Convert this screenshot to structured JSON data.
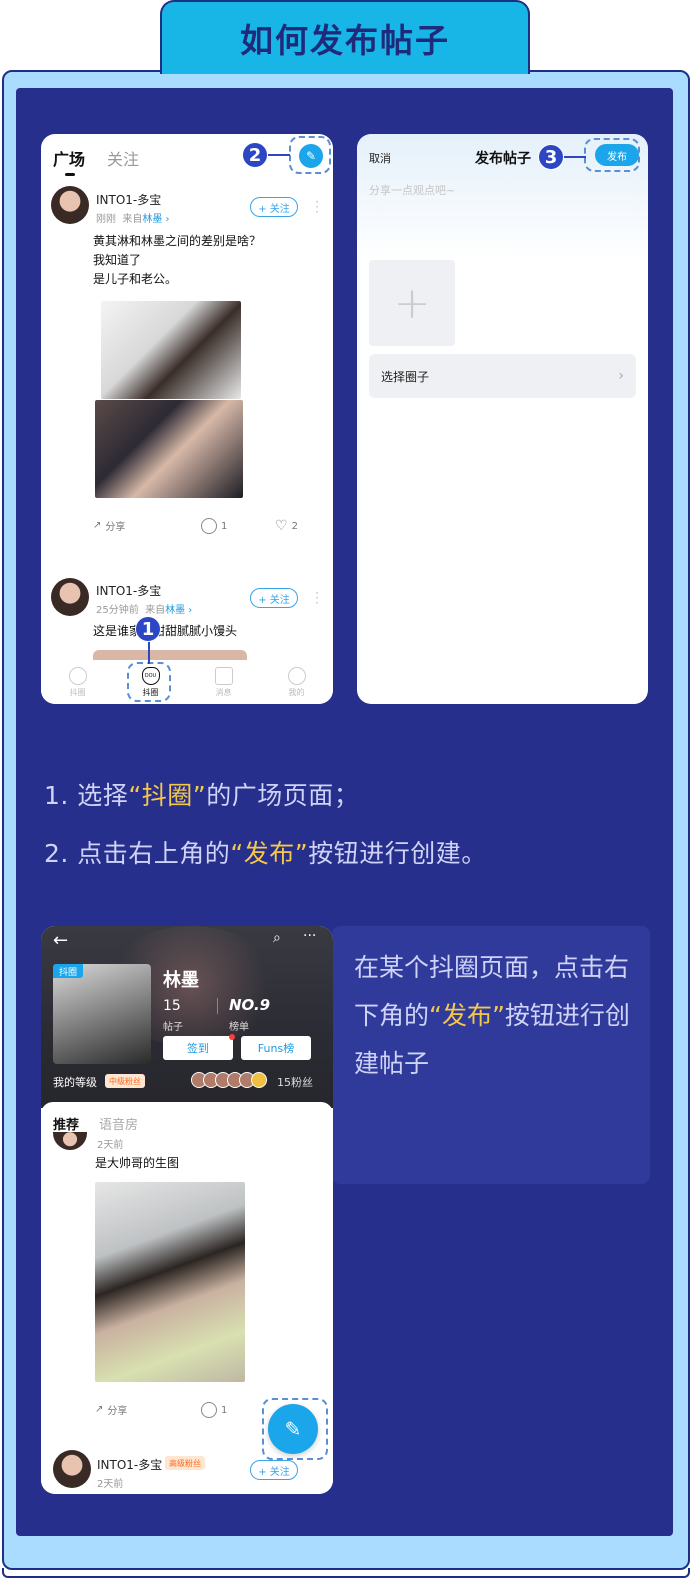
{
  "title": "如何发布帖子",
  "phone1": {
    "tabs": [
      "广场",
      "关注"
    ],
    "posts": [
      {
        "user": "INTO1-多宝",
        "time": "刚刚",
        "source_prefix": "来自",
        "source": "林墨",
        "follow": "+ 关注",
        "text": "黄其淋和林墨之间的差别是啥？\n我知道了\n是儿子和老公。",
        "share": "分享",
        "comments": "1",
        "likes": "2"
      },
      {
        "user": "INTO1-多宝",
        "time": "25分钟前",
        "source_prefix": "来自",
        "source": "林墨",
        "follow": "+ 关注",
        "text": "这是谁家的甜甜腻腻小馒头"
      }
    ],
    "nav": [
      "抖圈",
      "抖圈",
      "消息",
      "我的"
    ],
    "nav_active_glyph": "DOU"
  },
  "phone2": {
    "cancel": "取消",
    "title": "发布帖子",
    "publish": "发布",
    "placeholder": "分享一点观点吧~",
    "choose_circle": "选择圈子"
  },
  "steps": [
    "1",
    "2",
    "3"
  ],
  "instructions": {
    "line1_prefix": "1. 选择",
    "line1_highlight": "“抖圈”",
    "line1_suffix": "的广场页面；",
    "line2_prefix": "2.  点击右上角的",
    "line2_highlight": "“发布”",
    "line2_suffix": "按钮进行创建。"
  },
  "side": {
    "prefix": "在某个抖圈页面，点击右下角的",
    "highlight": "“发布”",
    "suffix": "按钮进行创建帖子"
  },
  "phone3": {
    "badge": "抖圈",
    "name": "林墨",
    "posts_count": "15",
    "posts_label": "帖子",
    "rank": "NO.9",
    "rank_label": "榜单",
    "checkin": "签到",
    "funs": "Funs榜",
    "level_label": "我的等级",
    "level_badge": "中级粉丝",
    "fans": "15粉丝",
    "tabs": [
      "推荐",
      "语音房"
    ],
    "post_time": "2天前",
    "post_text": "是大帅哥的生图",
    "share": "分享",
    "comments": "1",
    "next_user": "INTO1-多宝",
    "next_badge": "高级粉丝",
    "next_follow": "+ 关注",
    "next_time": "2天前"
  },
  "colors": {
    "accent": "#1ba5ea",
    "highlight": "#f6c84a",
    "panel": "#262f8b",
    "frame": "#a9dcff",
    "title_bg": "#18b6e6",
    "step": "#2d46c4"
  }
}
